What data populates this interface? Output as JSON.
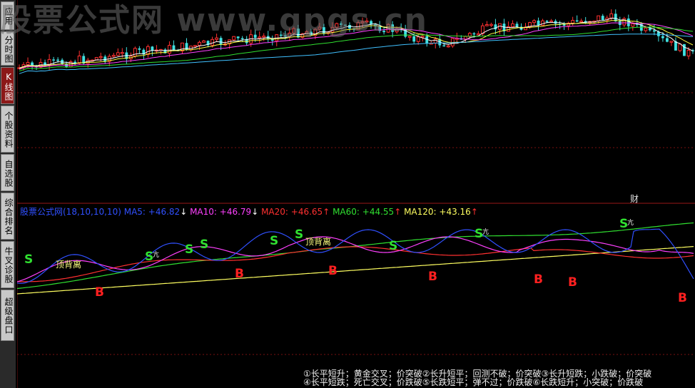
{
  "sidebar": {
    "tabs": [
      {
        "label": "应用",
        "active": false
      },
      {
        "label": "分时图",
        "active": false
      },
      {
        "label": "K线图",
        "active": true
      },
      {
        "label": "个股资料",
        "active": false
      },
      {
        "label": "自选股",
        "active": false
      },
      {
        "label": "综合排名",
        "active": false
      },
      {
        "label": "牛叉诊股",
        "active": false
      },
      {
        "label": "超级盘口",
        "active": false
      }
    ]
  },
  "watermark": "股票公式网 www.gpgs.cn",
  "indicator": {
    "name": "股票公式网(18,10,10,10)",
    "ma5": "MA5: +46.82",
    "ma5_arrow": "↓",
    "ma10": "MA10: +46.79",
    "ma10_arrow": "↓",
    "ma20": "MA20: +46.65",
    "ma20_arrow": "↑",
    "ma60": "MA60: +44.55",
    "ma60_arrow": "↑",
    "ma120": "MA120: +43.16",
    "ma120_arrow": "↑",
    "colors": {
      "name": "#3050ff",
      "ma5": "#3050ff",
      "ma10": "#ff40ff",
      "ma20": "#ff3030",
      "ma60": "#30e030",
      "ma120": "#ffff60"
    }
  },
  "cai_badge": "财",
  "signals": {
    "s_label": "S",
    "b_label": "B",
    "top_divergence": "顶背离",
    "kang": "亢"
  },
  "legend_notes": {
    "line1": "①长平短升；黄金交叉；价突破②长升短平；回测不破；价突破③长升短跌；小跌破；价突破",
    "line2": "④长平短跌；死亡交叉；价跌破⑤长跌短平；弹不过；价跌破⑥长跌短升；小突破；价跌破"
  }
}
